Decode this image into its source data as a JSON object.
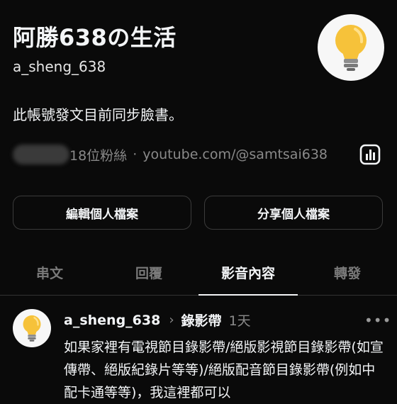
{
  "profile": {
    "display_name": "阿勝638の生活",
    "username": "a_sheng_638",
    "bio": "此帳號發文目前同步臉書。",
    "followers": "18位粉絲",
    "separator": "·",
    "link": "youtube.com/@samtsai638",
    "avatar_icon": "lightbulb-icon"
  },
  "actions": {
    "edit": "編輯個人檔案",
    "share": "分享個人檔案"
  },
  "tabs": [
    {
      "label": "串文",
      "active": false
    },
    {
      "label": "回覆",
      "active": false
    },
    {
      "label": "影音內容",
      "active": true
    },
    {
      "label": "轉發",
      "active": false
    }
  ],
  "post": {
    "username": "a_sheng_638",
    "topic": "錄影帶",
    "time": "1天",
    "more": "•••",
    "body": "如果家裡有電視節目錄影帶/絕版影視節目錄影帶(如宣傳帶、絕版紀錄片等等)/絕版配音節目錄影帶(例如中配卡通等等)，我這裡都可以"
  },
  "colors": {
    "background": "#0a0a0a",
    "text": "#f3f5f7",
    "muted": "#8a8a8a",
    "bulb": "#f6c23a"
  }
}
